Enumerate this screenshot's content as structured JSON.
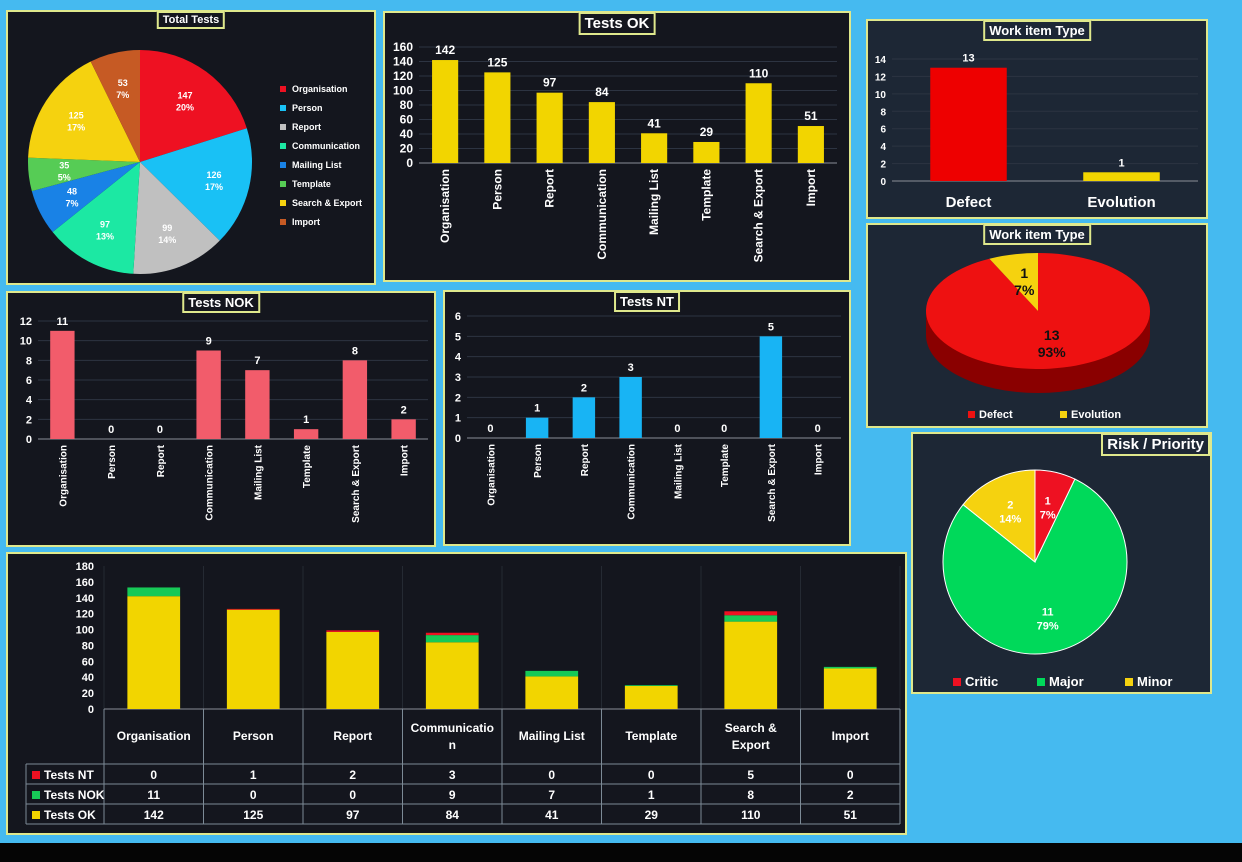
{
  "colors": {
    "yellow": "#f2d500",
    "red": "#ee0000",
    "pink": "#f25c6b",
    "cyan": "#18b4f4",
    "green": "#17c957",
    "axis_text": "#ffffff"
  },
  "chart_data": [
    {
      "id": "total-tests",
      "type": "pie",
      "title": "Total Tests",
      "legend_position": "right",
      "slices": [
        {
          "name": "Organisation",
          "value": 147,
          "pct_label": "20%",
          "color": "#ee1122"
        },
        {
          "name": "Person",
          "value": 126,
          "pct_label": "17%",
          "color": "#19c1f5"
        },
        {
          "name": "Report",
          "value": 99,
          "pct_label": "14%",
          "color": "#c0c0c0"
        },
        {
          "name": "Communication",
          "value": 97,
          "pct_label": "13%",
          "color": "#1ce8a3"
        },
        {
          "name": "Mailing List",
          "value": 48,
          "pct_label": "7%",
          "color": "#1982e6"
        },
        {
          "name": "Template",
          "value": 35,
          "pct_label": "5%",
          "color": "#56cc55"
        },
        {
          "name": "Search & Export",
          "value": 125,
          "pct_label": "17%",
          "color": "#f5d20f"
        },
        {
          "name": "Import",
          "value": 53,
          "pct_label": "7%",
          "color": "#c65a24"
        }
      ]
    },
    {
      "id": "tests-ok",
      "type": "bar",
      "title": "Tests OK",
      "categories": [
        "Organisation",
        "Person",
        "Report",
        "Communication",
        "Mailing List",
        "Template",
        "Search & Export",
        "Import"
      ],
      "values": [
        142,
        125,
        97,
        84,
        41,
        29,
        110,
        51
      ],
      "ylim": [
        0,
        160
      ],
      "yticks": [
        0,
        20,
        40,
        60,
        80,
        100,
        120,
        140,
        160
      ],
      "color": "#f2d500"
    },
    {
      "id": "work-item-bar",
      "type": "bar",
      "title": "Work item Type",
      "categories": [
        "Defect",
        "Evolution"
      ],
      "values": [
        13,
        1
      ],
      "ylim": [
        0,
        14
      ],
      "yticks": [
        0,
        2,
        4,
        6,
        8,
        10,
        12,
        14
      ],
      "colors": [
        "#ee0000",
        "#f2d500"
      ]
    },
    {
      "id": "work-item-pie",
      "type": "pie",
      "title": "Work item Type",
      "legend_position": "bottom",
      "slices": [
        {
          "name": "Defect",
          "value": 13,
          "pct_label": "93%",
          "color": "#ee1111"
        },
        {
          "name": "Evolution",
          "value": 1,
          "pct_label": "7%",
          "color": "#f5d20f"
        }
      ]
    },
    {
      "id": "tests-nok",
      "type": "bar",
      "title": "Tests NOK",
      "categories": [
        "Organisation",
        "Person",
        "Report",
        "Communication",
        "Mailing List",
        "Template",
        "Search & Export",
        "Import"
      ],
      "values": [
        11,
        0,
        0,
        9,
        7,
        1,
        8,
        2
      ],
      "ylim": [
        0,
        12
      ],
      "yticks": [
        0,
        2,
        4,
        6,
        8,
        10,
        12
      ],
      "color": "#f25c6b"
    },
    {
      "id": "tests-nt",
      "type": "bar",
      "title": "Tests NT",
      "categories": [
        "Organisation",
        "Person",
        "Report",
        "Communication",
        "Mailing List",
        "Template",
        "Search & Export",
        "Import"
      ],
      "values": [
        0,
        1,
        2,
        3,
        0,
        0,
        5,
        0
      ],
      "ylim": [
        0,
        6
      ],
      "yticks": [
        0,
        1,
        2,
        3,
        4,
        5,
        6
      ],
      "color": "#18b4f4"
    },
    {
      "id": "risk-priority",
      "type": "pie",
      "title": "Risk / Priority",
      "legend_position": "bottom",
      "slices": [
        {
          "name": "Critic",
          "value": 1,
          "pct_label": "7%",
          "color": "#ee1122"
        },
        {
          "name": "Major",
          "value": 11,
          "pct_label": "79%",
          "color": "#00d95a"
        },
        {
          "name": "Minor",
          "value": 2,
          "pct_label": "14%",
          "color": "#f5d20f"
        }
      ]
    },
    {
      "id": "stacked",
      "type": "bar",
      "stacked": true,
      "categories": [
        "Organisation",
        "Person",
        "Report",
        "Communication",
        "Mailing List",
        "Template",
        "Search & Export",
        "Import"
      ],
      "category_labels": [
        "Organisation",
        "Person",
        "Report",
        "Communicatio\nn",
        "Mailing List",
        "Template",
        "Search &\nExport",
        "Import"
      ],
      "ylim": [
        0,
        180
      ],
      "yticks": [
        0,
        20,
        40,
        60,
        80,
        100,
        120,
        140,
        160,
        180
      ],
      "series": [
        {
          "name": "Tests OK",
          "values": [
            142,
            125,
            97,
            84,
            41,
            29,
            110,
            51
          ],
          "color": "#f2d500"
        },
        {
          "name": "Tests NOK",
          "values": [
            11,
            0,
            0,
            9,
            7,
            1,
            8,
            2
          ],
          "color": "#17c957"
        },
        {
          "name": "Tests NT",
          "values": [
            0,
            1,
            2,
            3,
            0,
            0,
            5,
            0
          ],
          "color": "#ee1122"
        }
      ],
      "table_row_order": [
        "Tests NT",
        "Tests NOK",
        "Tests OK"
      ]
    }
  ]
}
